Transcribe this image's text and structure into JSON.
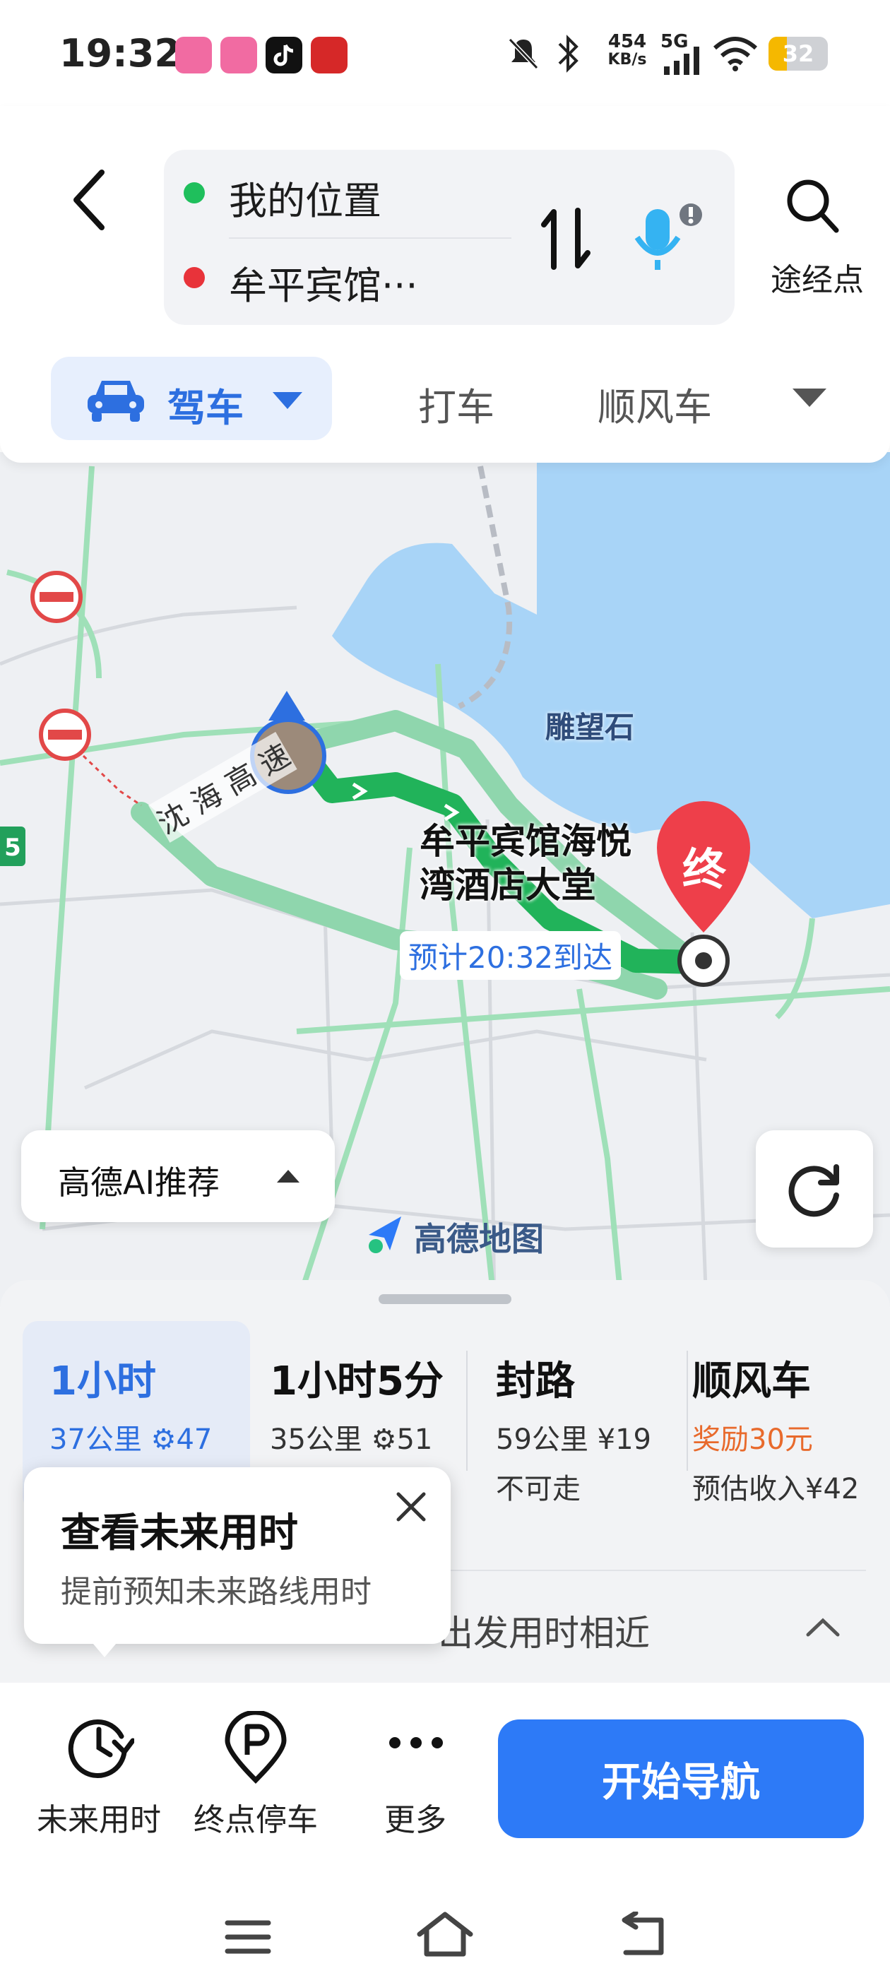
{
  "status_bar": {
    "time": "19:32",
    "net_speed_value": "454",
    "net_speed_unit": "KB/s",
    "network": "5G",
    "battery": "32",
    "icons": [
      "bilibili-icon",
      "bilibili-icon",
      "tiktok-icon",
      "news-app-icon",
      "mute-icon",
      "bluetooth-icon",
      "signal-icon",
      "wifi-icon",
      "battery-icon"
    ]
  },
  "route": {
    "origin": "我的位置",
    "destination": "牟平宾馆···",
    "origin_color": "#1fbf5c",
    "destination_color": "#e8333a",
    "waypoint_label": "途经点"
  },
  "modes": {
    "selected": "驾车",
    "tabs": [
      "打车",
      "顺风车"
    ]
  },
  "map": {
    "place_label": "雕望石",
    "road_label": "沈 海 高 速",
    "destination_name_line1": "牟平宾馆海悦",
    "destination_name_line2": "湾酒店大堂",
    "eta_label": "预计20:32到达",
    "end_marker": "终",
    "ai_recommend": "高德AI推荐",
    "brand": "高德地图",
    "shield_num": "5",
    "colors": {
      "water": "#a8d4f7",
      "route": "#21b35a",
      "route_alt": "#8fd6ad",
      "land": "#eef0f3"
    }
  },
  "routes": [
    {
      "title": "1小时",
      "distance": "37公里",
      "lights": "47",
      "selected": true
    },
    {
      "title": "1小时5分",
      "distance": "35公里",
      "lights": "51"
    },
    {
      "title": "封路",
      "distance": "59公里",
      "cost": "¥19",
      "note": "不可走"
    },
    {
      "title": "顺风车",
      "reward": "奖励30元",
      "income": "预估收入¥42"
    }
  ],
  "sheet_hint": "出发用时相近",
  "tooltip": {
    "title": "查看未来用时",
    "subtitle": "提前预知未来路线用时"
  },
  "actions": {
    "future_time": "未来用时",
    "destination_parking": "终点停车",
    "more": "更多",
    "start_nav": "开始导航"
  }
}
